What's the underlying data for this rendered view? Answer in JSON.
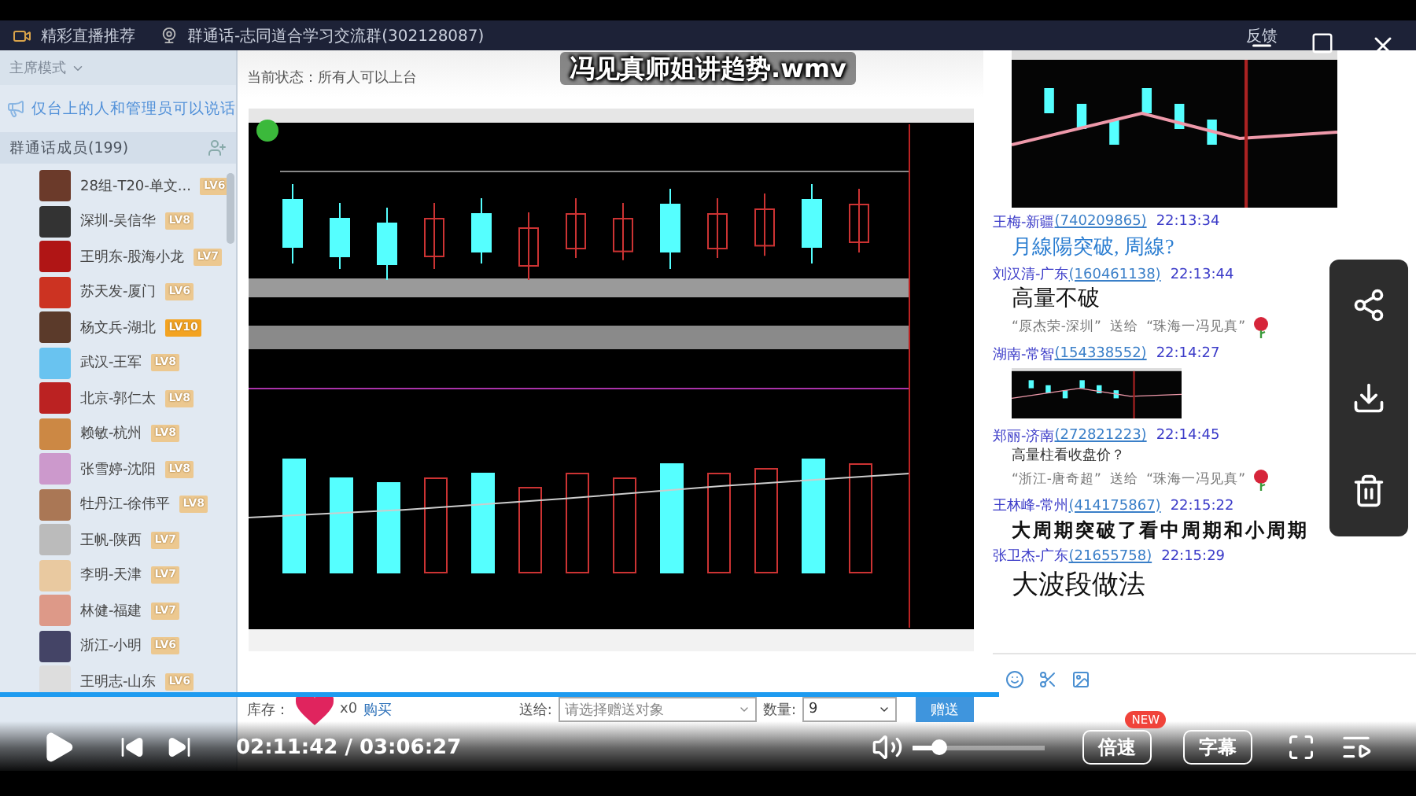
{
  "recording": {
    "header": {
      "live_tab": "精彩直播推荐",
      "group_title": "群通话-志同道合学习交流群(302128087)",
      "feedback": "反馈"
    },
    "sidebar": {
      "mode": "主席模式",
      "notice": "仅台上的人和管理员可以说话",
      "members_title": "群通话成员(199)",
      "members": [
        {
          "name": "28组-T20-单文...",
          "level": "LV6",
          "color": "#ecc890"
        },
        {
          "name": "深圳-吴信华",
          "level": "LV8",
          "color": "#ecc890"
        },
        {
          "name": "王明东-股海小龙",
          "level": "LV7",
          "color": "#ecc890"
        },
        {
          "name": "苏天发-厦门",
          "level": "LV6",
          "color": "#ecc890"
        },
        {
          "name": "杨文兵-湖北",
          "level": "LV10",
          "color": "#f3a321"
        },
        {
          "name": "武汉-王军",
          "level": "LV8",
          "color": "#ecc890"
        },
        {
          "name": "北京-郭仁太",
          "level": "LV8",
          "color": "#ecc890"
        },
        {
          "name": "赖敏-杭州",
          "level": "LV8",
          "color": "#ecc890"
        },
        {
          "name": "张雪婷-沈阳",
          "level": "LV8",
          "color": "#ecc890"
        },
        {
          "name": "牡丹江-徐伟平",
          "level": "LV8",
          "color": "#ecc890"
        },
        {
          "name": "王帆-陕西",
          "level": "LV7",
          "color": "#ecc890"
        },
        {
          "name": "李明-天津",
          "level": "LV7",
          "color": "#ecc890"
        },
        {
          "name": "林健-福建",
          "level": "LV7",
          "color": "#ecc890"
        },
        {
          "name": "浙江-小明",
          "level": "LV6",
          "color": "#ecc890"
        },
        {
          "name": "王明志-山东",
          "level": "LV6",
          "color": "#ecc890"
        }
      ]
    },
    "stage": {
      "status": "当前状态：所有人可以上台"
    },
    "gift_bar": {
      "stock_label": "库存：",
      "count": "x0",
      "buy": "购买",
      "to_label": "送给:",
      "to_placeholder": "请选择赠送对象",
      "qty_label": "数量:",
      "qty": "9",
      "send": "赠送"
    },
    "chat": {
      "entries": [
        {
          "kind": "image"
        },
        {
          "kind": "message",
          "sender": "王梅-新疆",
          "qq": "(740209865)",
          "time": "22:13:34",
          "content": {
            "kind": "text",
            "text": "月線陽突破, 周線?"
          }
        },
        {
          "kind": "message",
          "sender": "刘汉清-广东",
          "qq": "(160461138)",
          "time": "22:13:44",
          "content": {
            "kind": "text",
            "text": "高量不破"
          }
        },
        {
          "kind": "gift",
          "text": "“原杰荣-深圳”  送给  “珠海一冯见真”"
        },
        {
          "kind": "message",
          "sender": "湖南-常智",
          "qq": "(154338552)",
          "time": "22:14:27",
          "content": {
            "kind": "image"
          }
        },
        {
          "kind": "message",
          "sender": "郑丽-济南",
          "qq": "(272821223)",
          "time": "22:14:45",
          "content": {
            "kind": "text",
            "text": "高量柱看收盘价？"
          }
        },
        {
          "kind": "gift",
          "text": "“浙江-唐奇超”  送给  “珠海一冯见真”"
        },
        {
          "kind": "message",
          "sender": "王林峰-常州",
          "qq": "(414175867)",
          "time": "22:15:22",
          "content": {
            "kind": "text",
            "text": "大周期突破了看中周期和小周期"
          }
        },
        {
          "kind": "message",
          "sender": "张卫杰-广东",
          "qq": "(21655758)",
          "time": "22:15:29",
          "content": {
            "kind": "text",
            "text": "大波段做法"
          }
        }
      ]
    }
  },
  "player": {
    "title": "冯见真师姐讲趋势.wmv",
    "progress": {
      "level": 0.705
    },
    "time": "02:11:42 / 03:06:27",
    "volume": {
      "level": 0.2
    },
    "speed": "倍速",
    "speed_badge": "NEW",
    "subtitles": "字幕"
  }
}
